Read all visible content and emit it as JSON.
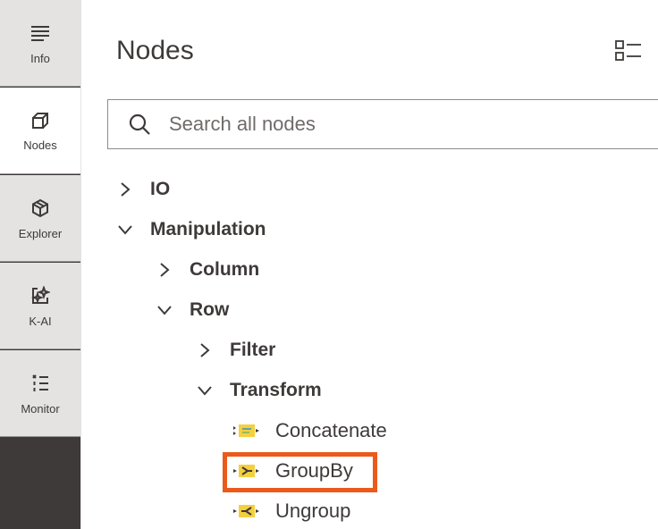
{
  "rail": {
    "items": [
      {
        "label": "Info",
        "icon": "info-lines-icon"
      },
      {
        "label": "Nodes",
        "icon": "nodes-cube-icon"
      },
      {
        "label": "Explorer",
        "icon": "explorer-box-icon"
      },
      {
        "label": "K-AI",
        "icon": "k-ai-sparkle-icon"
      },
      {
        "label": "Monitor",
        "icon": "monitor-list-icon"
      }
    ]
  },
  "panel": {
    "title": "Nodes",
    "display_toggle_icon": "list-view-icon"
  },
  "search": {
    "placeholder": "Search all nodes",
    "value": ""
  },
  "tree": {
    "io": "IO",
    "manipulation": "Manipulation",
    "column": "Column",
    "row": "Row",
    "filter": "Filter",
    "transform": "Transform",
    "nodes": [
      {
        "label": "Concatenate",
        "icon": "concatenate-node-icon"
      },
      {
        "label": "GroupBy",
        "icon": "groupby-node-icon"
      },
      {
        "label": "Ungroup",
        "icon": "ungroup-node-icon"
      }
    ]
  },
  "colors": {
    "highlight": "#ea5a1a",
    "node_yellow": "#f4d03f",
    "rail_bg": "#e4e3e1",
    "dark_bg": "#3e3a39"
  }
}
